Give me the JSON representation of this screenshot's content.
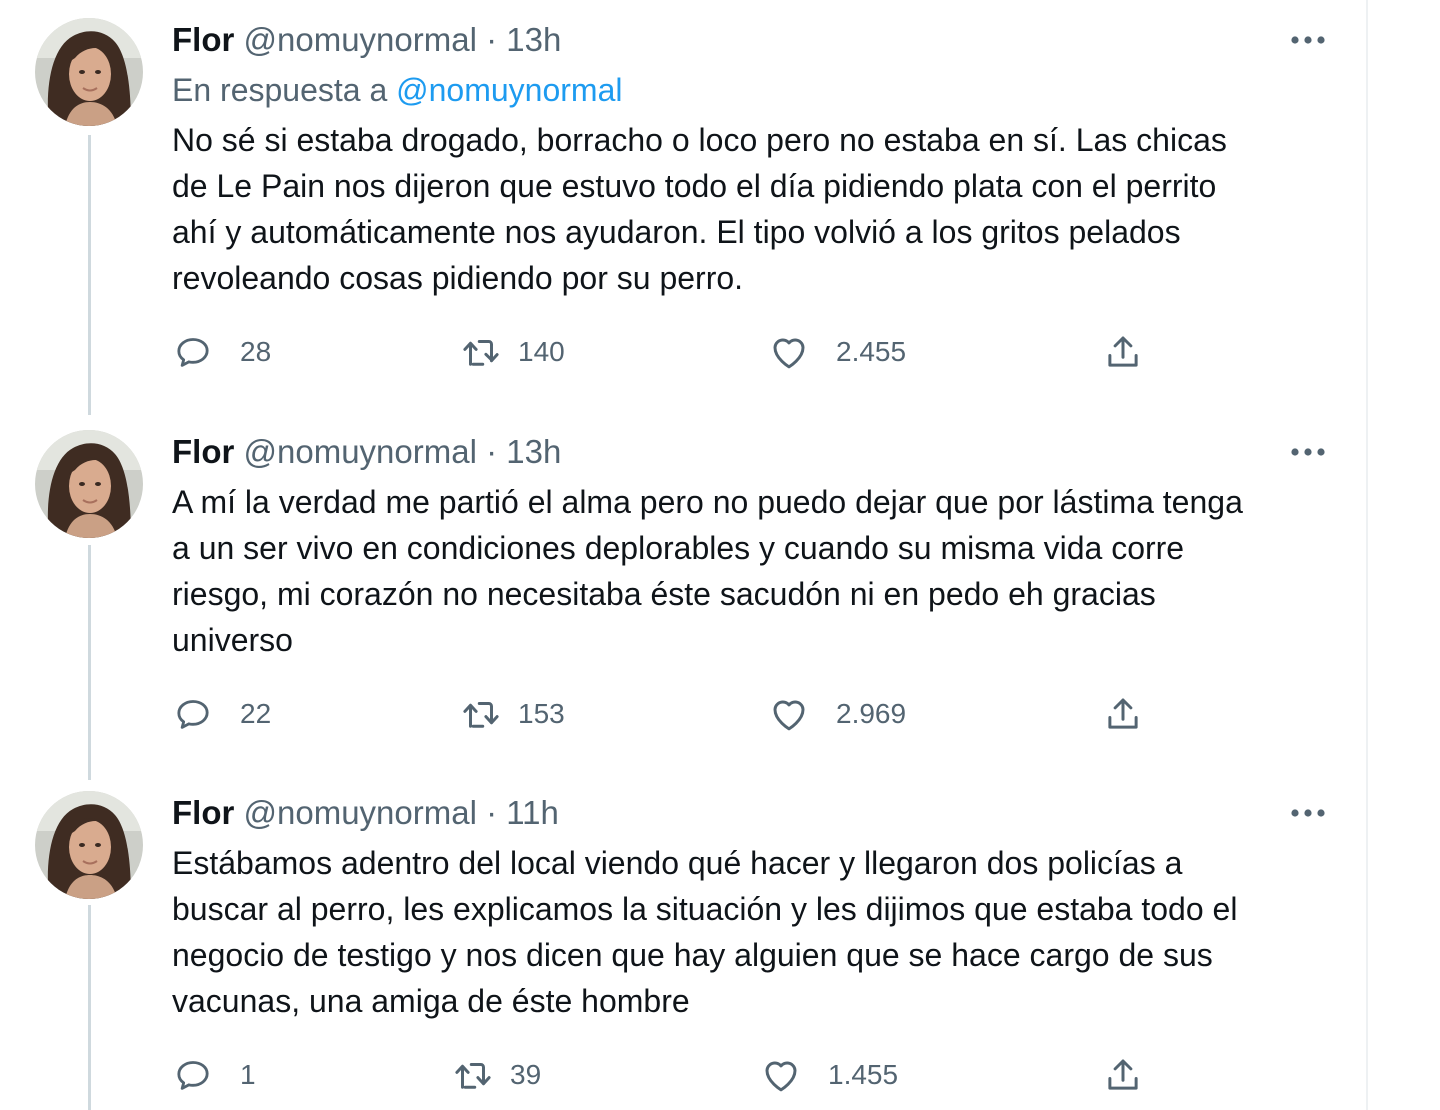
{
  "tweets": [
    {
      "name": "Flor",
      "handle": "@nomuynormal",
      "separator": "·",
      "time": "13h",
      "reply_to_prefix": "En respuesta a",
      "reply_to_handle": "@nomuynormal",
      "lines": [
        "No sé si estaba drogado, borracho o loco pero no estaba en sí. Las chicas",
        "de Le Pain nos dijeron que estuvo todo el día pidiendo plata con el perrito",
        "ahí y automáticamente nos ayudaron. El tipo volvió a los gritos pelados",
        "revoleando cosas pidiendo por su perro."
      ],
      "replies": "28",
      "retweets": "140",
      "likes": "2.455"
    },
    {
      "name": "Flor",
      "handle": "@nomuynormal",
      "separator": "·",
      "time": "13h",
      "lines": [
        "A mí la verdad me partió el alma pero no puedo dejar que por lástima tenga",
        "a un ser vivo en condiciones deplorables y cuando su misma vida corre",
        "riesgo, mi corazón no necesitaba éste sacudón ni en pedo eh gracias",
        "universo"
      ],
      "replies": "22",
      "retweets": "153",
      "likes": "2.969"
    },
    {
      "name": "Flor",
      "handle": "@nomuynormal",
      "separator": "·",
      "time": "11h",
      "lines": [
        "Estábamos adentro del local viendo qué hacer y llegaron dos policías a",
        "buscar al perro, les explicamos la situación y les dijimos que estaba todo el",
        "negocio de testigo y nos dicen que hay alguien que se hace cargo de sus",
        "vacunas, una amiga de éste hombre"
      ],
      "replies": "1",
      "retweets": "39",
      "likes": "1.455"
    }
  ],
  "icons": {
    "reply": "reply-icon",
    "retweet": "retweet-icon",
    "like": "heart-icon",
    "share": "share-icon",
    "more": "more-icon"
  },
  "colors": {
    "text": "#0f1419",
    "secondary": "#536471",
    "link": "#1d9bf0",
    "thread_line": "#cfd9de"
  }
}
